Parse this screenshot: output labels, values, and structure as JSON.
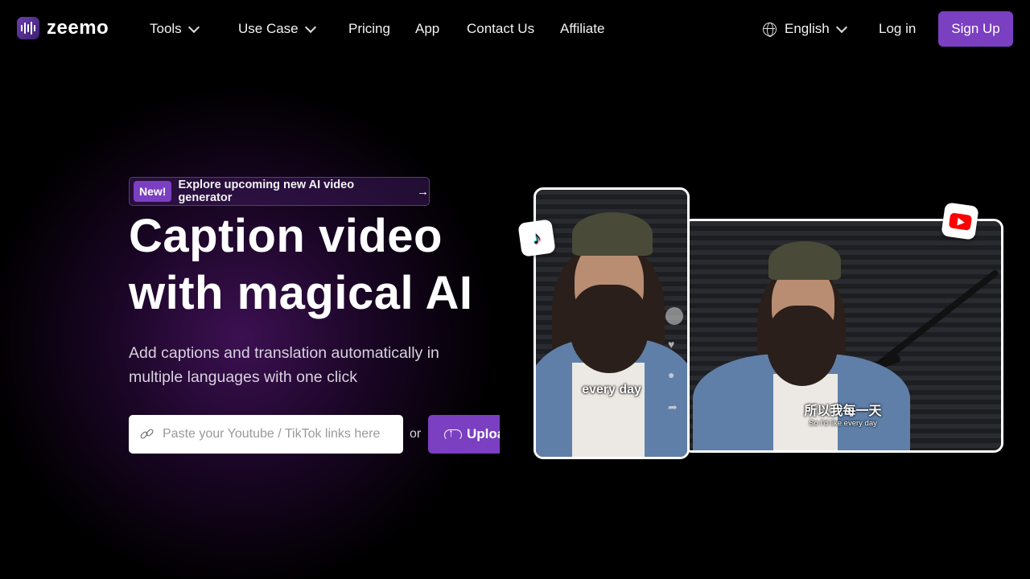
{
  "nav": {
    "logo_text": "zeemo",
    "items": [
      {
        "label": "Tools",
        "has_dropdown": true
      },
      {
        "label": "Use Case",
        "has_dropdown": true
      },
      {
        "label": "Pricing"
      },
      {
        "label": "App"
      },
      {
        "label": "Contact Us"
      },
      {
        "label": "Affiliate"
      }
    ],
    "language": "English",
    "login_label": "Log in",
    "signup_label": "Sign Up"
  },
  "hero": {
    "badge_new": "New!",
    "badge_text": "Explore upcoming new AI video generator",
    "badge_arrow": "→",
    "headline_line1": "Caption video",
    "headline_line2": "with magical AI",
    "subhead": "Add captions and translation automatically in multiple languages with one click",
    "link_input": {
      "placeholder": "Paste your Youtube / TikTok links here",
      "value": ""
    },
    "or_text": "or",
    "upload_label": "Upload"
  },
  "preview": {
    "portrait_caption": "every day",
    "landscape_caption_zh": "所以我每一天",
    "landscape_caption_en": "So I'd like every day",
    "tiktok_glyph": "♪",
    "icons": [
      "tiktok-icon",
      "youtube-icon",
      "link-icon",
      "upload-cloud-icon",
      "globe-icon",
      "chevron-down-icon"
    ]
  },
  "colors": {
    "accent": "#7b3fc2",
    "background": "#000000"
  }
}
